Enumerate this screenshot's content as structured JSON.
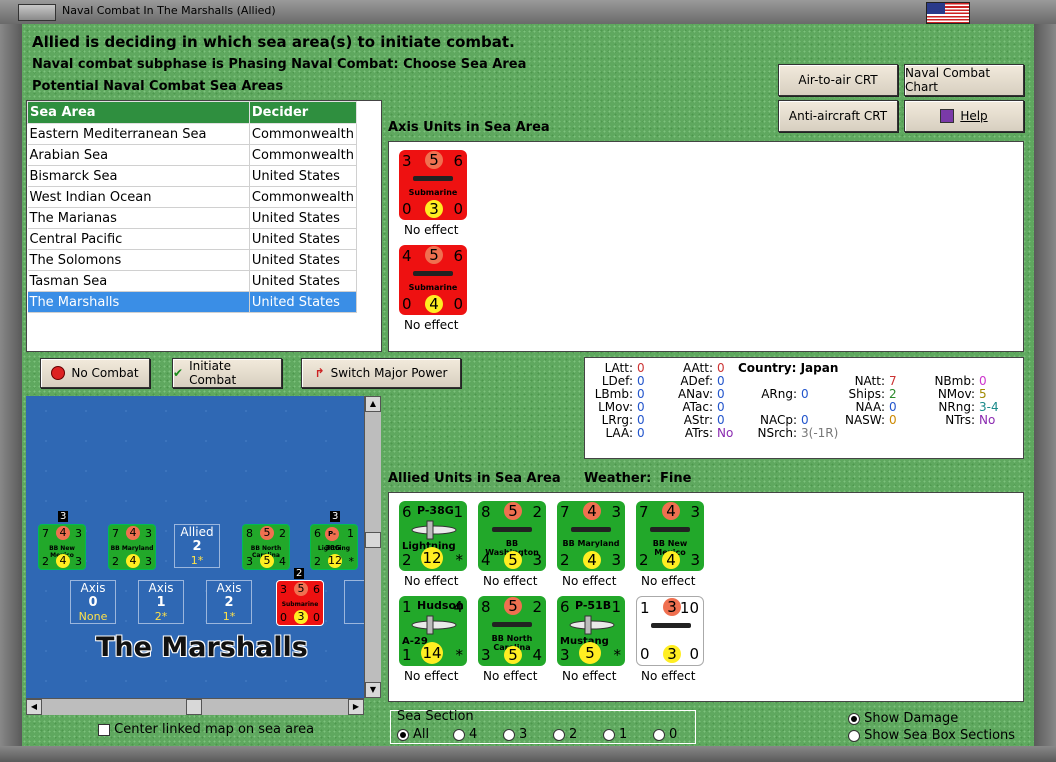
{
  "window": {
    "title": "Naval Combat In The Marshalls (Allied)"
  },
  "header": {
    "line1": "Allied is deciding in which sea area(s) to initiate combat.",
    "line2": "Naval combat subphase is Phasing Naval Combat: Choose Sea Area",
    "line3": "Potential Naval Combat Sea Areas"
  },
  "buttons": {
    "air_to_air": "Air-to-air CRT",
    "naval_chart": "Naval Combat Chart",
    "anti_aircraft": "Anti-aircraft CRT",
    "help": "Help",
    "no_combat": "No Combat",
    "initiate": "Initiate Combat",
    "switch_power": "Switch Major Power"
  },
  "sea_table": {
    "headers": [
      "Sea Area",
      "Decider"
    ],
    "rows": [
      [
        "Eastern Mediterranean Sea",
        "Commonwealth"
      ],
      [
        "Arabian Sea",
        "Commonwealth"
      ],
      [
        "Bismarck Sea",
        "United States"
      ],
      [
        "West Indian Ocean",
        "Commonwealth"
      ],
      [
        "The Marianas",
        "United States"
      ],
      [
        "Central Pacific",
        "United States"
      ],
      [
        "The Solomons",
        "United States"
      ],
      [
        "Tasman Sea",
        "United States"
      ],
      [
        "The Marshalls",
        "United States"
      ]
    ],
    "selected_index": 8
  },
  "axis_section": {
    "title": "Axis Units in Sea Area",
    "units": [
      {
        "tl": "3",
        "top": "5",
        "tr": "6",
        "name": "Submarine",
        "bl": "0",
        "bottom": "3",
        "br": "0",
        "effect": "No effect"
      },
      {
        "tl": "4",
        "top": "5",
        "tr": "6",
        "name": "Submarine",
        "bl": "0",
        "bottom": "4",
        "br": "0",
        "effect": "No effect"
      }
    ]
  },
  "stats": {
    "country_label": "Country: Japan",
    "col1": [
      [
        "LAtt:",
        "0"
      ],
      [
        "LDef:",
        "0"
      ],
      [
        "LBmb:",
        "0"
      ],
      [
        "LMov:",
        "0"
      ],
      [
        "LRrg:",
        "0"
      ],
      [
        "LAA:",
        "0"
      ]
    ],
    "col2": [
      [
        "AAtt:",
        "0"
      ],
      [
        "ADef:",
        "0"
      ],
      [
        "ANav:",
        "0"
      ],
      [
        "ATac:",
        "0"
      ],
      [
        "AStr:",
        "0"
      ],
      [
        "ATrs:",
        "No"
      ]
    ],
    "col3": [
      [
        "ARng:",
        "0"
      ],
      [
        "NACp:",
        "0"
      ],
      [
        "NSrch:",
        "3(-1R)"
      ]
    ],
    "col4": [
      [
        "NAtt:",
        "7"
      ],
      [
        "Ships:",
        "2"
      ],
      [
        "NAA:",
        "0"
      ],
      [
        "NASW:",
        "0"
      ]
    ],
    "col5": [
      [
        "NBmb:",
        "0"
      ],
      [
        "NMov:",
        "5"
      ],
      [
        "NRng:",
        "3-4"
      ],
      [
        "NTrs:",
        "No"
      ]
    ]
  },
  "allied_section": {
    "title": "Allied Units in Sea Area",
    "weather_label": "Weather:",
    "weather_value": "Fine",
    "units": [
      {
        "tl": "6",
        "top": "P-38G",
        "tr": "1",
        "name": "Lightning",
        "bl": "2",
        "bottom": "12",
        "br": "*",
        "effect": "No effect",
        "kind": "plane"
      },
      {
        "tl": "8",
        "top": "5",
        "tr": "2",
        "name": "BB Washington",
        "bl": "4",
        "bottom": "5",
        "br": "3",
        "effect": "No effect",
        "kind": "ship"
      },
      {
        "tl": "7",
        "top": "4",
        "tr": "3",
        "name": "BB Maryland",
        "bl": "2",
        "bottom": "4",
        "br": "3",
        "effect": "No effect",
        "kind": "ship"
      },
      {
        "tl": "7",
        "top": "4",
        "tr": "3",
        "name": "BB New Mexico",
        "bl": "2",
        "bottom": "4",
        "br": "3",
        "effect": "No effect",
        "kind": "ship"
      },
      {
        "tl": "1",
        "top": "Hudson",
        "tr": "4",
        "name": "A-29",
        "bl": "1",
        "bottom": "14",
        "br": "*",
        "effect": "No effect",
        "kind": "plane"
      },
      {
        "tl": "8",
        "top": "5",
        "tr": "2",
        "name": "BB North Carolina",
        "bl": "3",
        "bottom": "5",
        "br": "4",
        "effect": "No effect",
        "kind": "ship"
      },
      {
        "tl": "6",
        "top": "P-51B",
        "tr": "1",
        "name": "Mustang",
        "bl": "3",
        "bottom": "5",
        "br": "*",
        "effect": "No effect",
        "kind": "plane"
      },
      {
        "tl": "1",
        "top": "3",
        "tr": "10",
        "name": "",
        "bl": "0",
        "bottom": "3",
        "br": "0",
        "effect": "No effect",
        "kind": "ship"
      }
    ]
  },
  "map": {
    "name": "The Marshalls",
    "top_units": [
      {
        "a": "7",
        "o": "4",
        "b": "3",
        "n": "BB New Mexico",
        "c": "2",
        "y": "4",
        "d": "3",
        "badge": "3"
      },
      {
        "a": "7",
        "o": "4",
        "b": "3",
        "n": "BB Maryland",
        "c": "2",
        "y": "4",
        "d": "3",
        "badge": ""
      },
      {
        "a": "8",
        "o": "5",
        "b": "2",
        "n": "BB North Carolina",
        "c": "3",
        "y": "5",
        "d": "4",
        "badge": ""
      },
      {
        "a": "6",
        "o": "P-38G",
        "b": "1",
        "n": "Lightning",
        "c": "2",
        "y": "12",
        "d": "*",
        "badge": "3"
      }
    ],
    "allied_box": {
      "label": "Allied",
      "value": "2",
      "sub": "1*"
    },
    "axis_boxes": [
      {
        "label": "Axis",
        "value": "0",
        "sub": "None"
      },
      {
        "label": "Axis",
        "value": "1",
        "sub": "2*"
      },
      {
        "label": "Axis",
        "value": "2",
        "sub": "1*"
      }
    ],
    "axis_sub": {
      "a": "3",
      "o": "5",
      "b": "6",
      "n": "Submarine",
      "c": "0",
      "y": "3",
      "d": "0",
      "badge": "2"
    }
  },
  "bottom": {
    "center_map": "Center linked map on sea area",
    "sea_section_title": "Sea Section",
    "sea_section_options": [
      "All",
      "4",
      "3",
      "2",
      "1",
      "0"
    ],
    "show_damage": "Show Damage",
    "show_sea_box": "Show Sea Box Sections"
  },
  "colors": {
    "panel_green": "#5fa85f",
    "header_green": "#2f8f3f",
    "selection_blue": "#3a8ee6",
    "axis_red": "#ee1111",
    "allied_green": "#22a82a"
  }
}
